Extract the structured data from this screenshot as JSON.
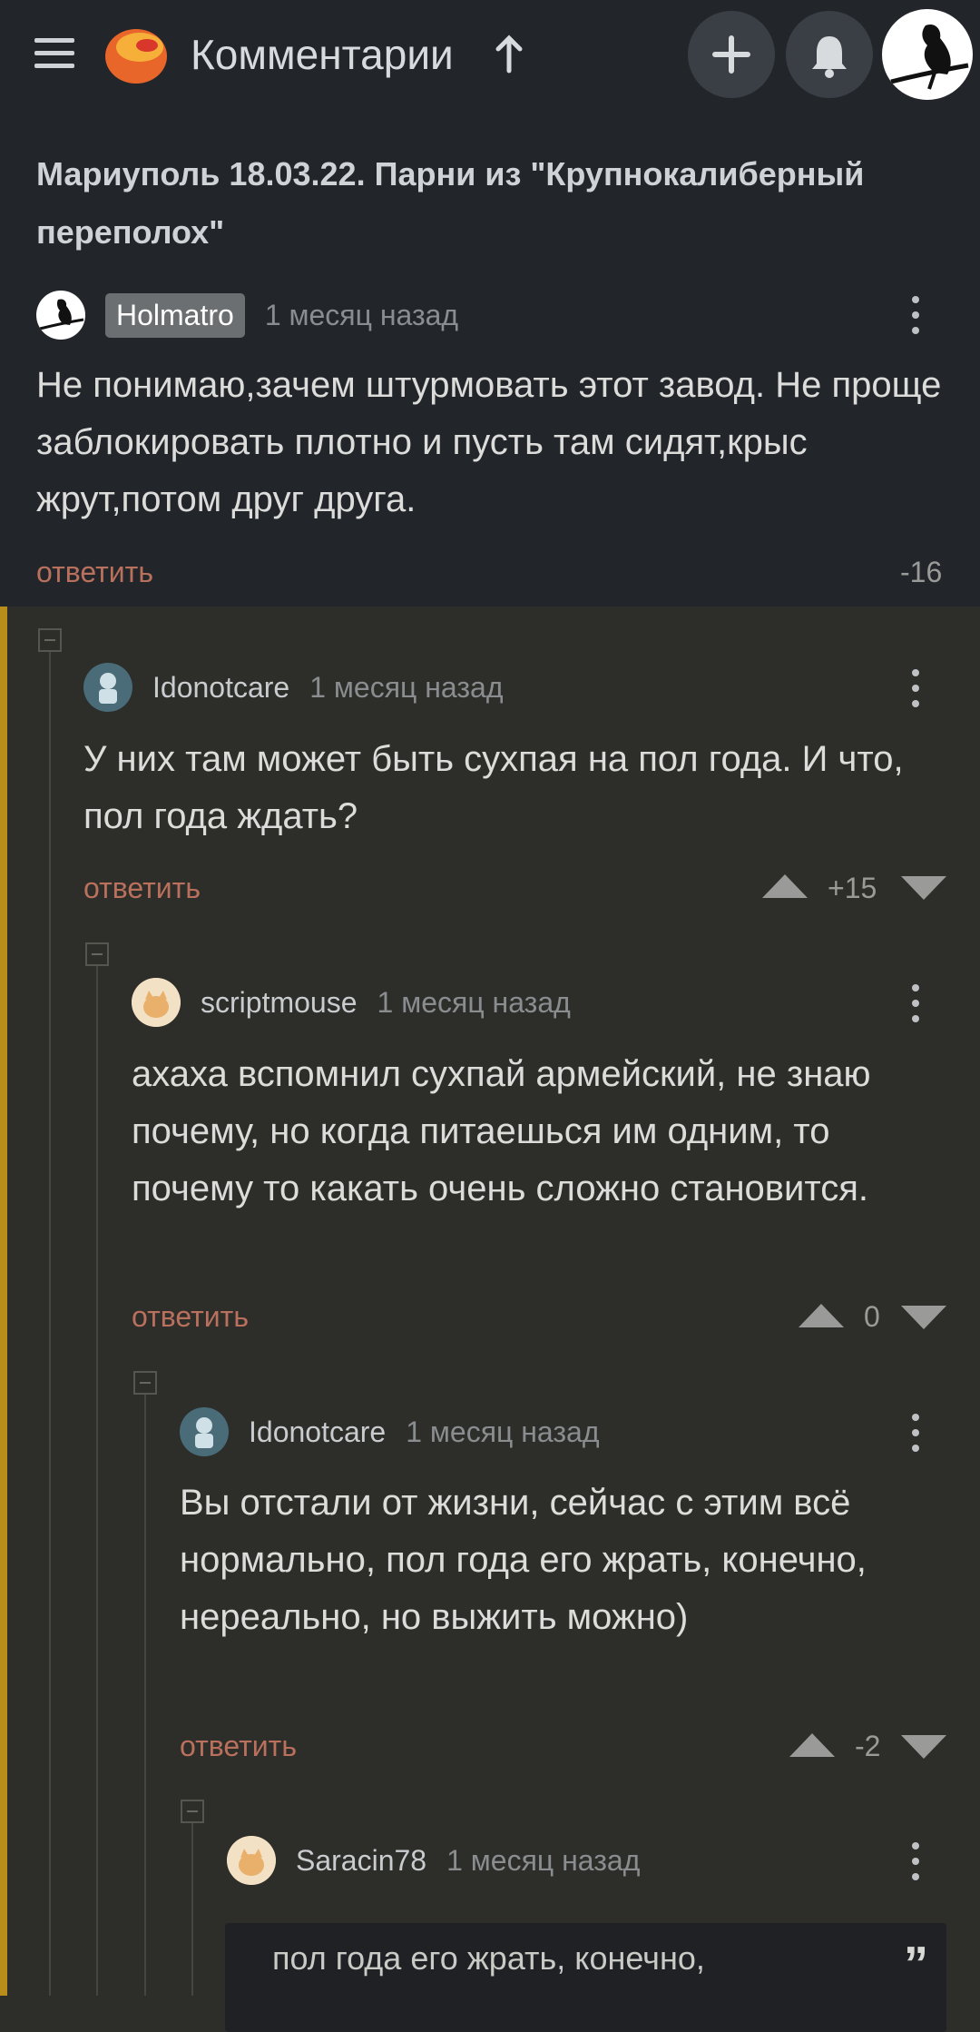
{
  "header": {
    "title": "Комментарии",
    "icons": [
      "menu-icon",
      "pikabu-logo",
      "sort-up-icon",
      "plus-icon",
      "bell-icon",
      "profile-avatar"
    ]
  },
  "post": {
    "title": "Мариуполь 18.03.22. Парни из \"Крупнокалиберный переполох\""
  },
  "comments": [
    {
      "author": "Holmatro",
      "time": "1 месяц назад",
      "text": "Не понимаю,зачем штурмовать этот завод. Не проще заблокировать плотно и пусть там сидят,крыс жрут,потом друг друга.",
      "reply": "ответить",
      "score": "-16"
    },
    {
      "author": "Idonotcare",
      "time": "1 месяц назад",
      "text": "У них там может быть сухпая на пол года. И что, пол года ждать?",
      "reply": "ответить",
      "score": "+15"
    },
    {
      "author": "scriptmouse",
      "time": "1 месяц назад",
      "text": "ахаха вспомнил сухпай армейский, не знаю почему, но когда питаешься им одним, то почему то какать очень сложно становится.",
      "reply": "ответить",
      "score": "0"
    },
    {
      "author": "Idonotcare",
      "time": "1 месяц назад",
      "text": "Вы отстали от жизни, сейчас с этим всё нормально, пол года его жрать, конечно, нереально, но выжить можно)",
      "reply": "ответить",
      "score": "-2"
    },
    {
      "author": "Saracin78",
      "time": "1 месяц назад",
      "quote": "пол года его жрать, конечно,"
    }
  ],
  "colors": {
    "header_bg": "#22262b",
    "thread_bg": "#2d2d2a",
    "accent_stripe": "#b88d1a",
    "reply_link": "#b9705c"
  }
}
